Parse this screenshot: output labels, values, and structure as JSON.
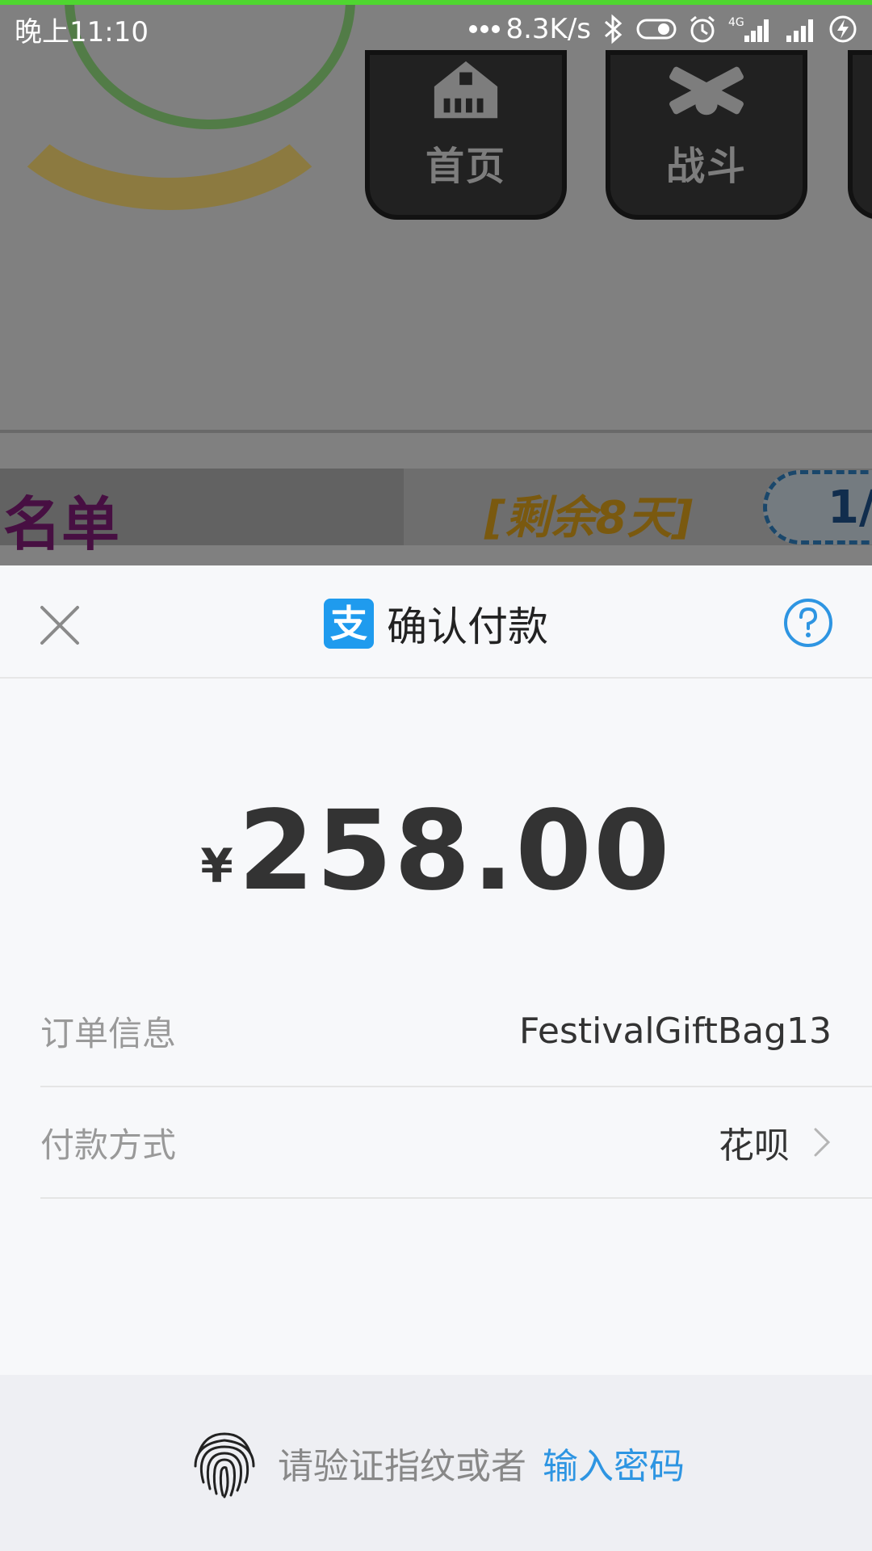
{
  "status_bar": {
    "time": "晚上11:10",
    "network_speed": "8.3K/s",
    "network_type": "4G",
    "icons": [
      "bluetooth-icon",
      "toggle-icon",
      "alarm-icon",
      "signal-4g-icon",
      "signal-icon",
      "charging-icon"
    ]
  },
  "background_game": {
    "nav_buttons": [
      {
        "label": "首页",
        "icon": "home-icon"
      },
      {
        "label": "战斗",
        "icon": "battle-icon"
      }
    ],
    "list_name": "名单",
    "remaining": "[剩余8天]",
    "page_indicator": "1/"
  },
  "payment": {
    "title": "确认付款",
    "brand_glyph": "支",
    "currency_symbol": "¥",
    "amount": "258.00",
    "order_info_label": "订单信息",
    "order_info_value": "FestivalGiftBag13",
    "payment_method_label": "付款方式",
    "payment_method_value": "花呗",
    "fingerprint_hint": "请验证指纹或者",
    "enter_password_label": "输入密码"
  },
  "colors": {
    "accent_blue": "#2e95e2",
    "alipay_blue": "#1f9bee",
    "progress_green": "#4fd630",
    "sheet_background": "#f7f8fa",
    "footer_background": "#eeeff3"
  }
}
